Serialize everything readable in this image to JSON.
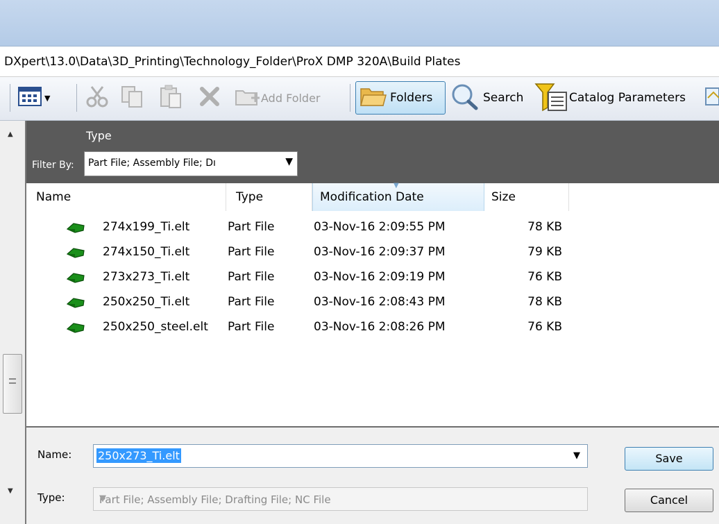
{
  "path": "DXpert\\13.0\\Data\\3D_Printing\\Technology_Folder\\ProX DMP 320A\\Build Plates",
  "toolbar": {
    "add_folder": "Add Folder",
    "folders": "Folders",
    "search": "Search",
    "catalog_parameters": "Catalog Parameters"
  },
  "filter": {
    "type_label": "Type",
    "filter_by_label": "Filter By:",
    "value": "Part File; Assembly File; Dı"
  },
  "columns": {
    "name": "Name",
    "type": "Type",
    "modification_date": "Modification Date",
    "size": "Size"
  },
  "files": [
    {
      "name": "274x199_Ti.elt",
      "type": "Part File",
      "date": "03-Nov-16 2:09:55 PM",
      "size": "78 KB"
    },
    {
      "name": "274x150_Ti.elt",
      "type": "Part File",
      "date": "03-Nov-16 2:09:37 PM",
      "size": "79 KB"
    },
    {
      "name": "273x273_Ti.elt",
      "type": "Part File",
      "date": "03-Nov-16 2:09:19 PM",
      "size": "76 KB"
    },
    {
      "name": "250x250_Ti.elt",
      "type": "Part File",
      "date": "03-Nov-16 2:08:43 PM",
      "size": "78 KB"
    },
    {
      "name": "250x250_steel.elt",
      "type": "Part File",
      "date": "03-Nov-16 2:08:26 PM",
      "size": "76 KB"
    }
  ],
  "form": {
    "name_label": "Name:",
    "name_value": "250x273_Ti.elt",
    "type_label": "Type:",
    "type_value": "Part File; Assembly File; Drafting File; NC File",
    "save_label": "Save",
    "cancel_label": "Cancel"
  },
  "colors": {
    "accent": "#3399ff",
    "part_icon": "#1a8f1a",
    "header_bg": "#5a5a5a"
  }
}
